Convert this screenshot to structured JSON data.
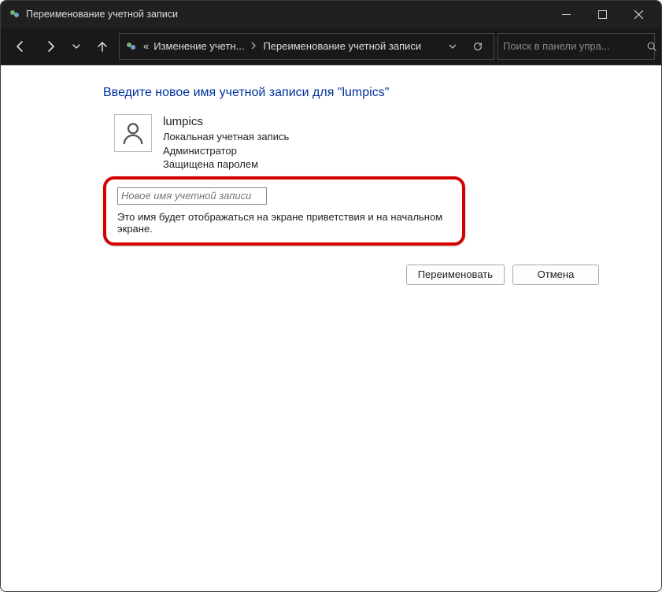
{
  "window": {
    "title": "Переименование учетной записи"
  },
  "breadcrumb": {
    "prefix": "«",
    "seg1": "Изменение учетн...",
    "seg2": "Переименование учетной записи"
  },
  "search": {
    "placeholder": "Поиск в панели упра..."
  },
  "main": {
    "heading": "Введите новое имя учетной записи для \"lumpics\"",
    "account": {
      "name": "lumpics",
      "line1": "Локальная учетная запись",
      "line2": "Администратор",
      "line3": "Защищена паролем"
    },
    "input_placeholder": "Новое имя учетной записи",
    "hint": "Это имя будет отображаться на экране приветствия и на начальном экране.",
    "btn_rename": "Переименовать",
    "btn_cancel": "Отмена"
  }
}
